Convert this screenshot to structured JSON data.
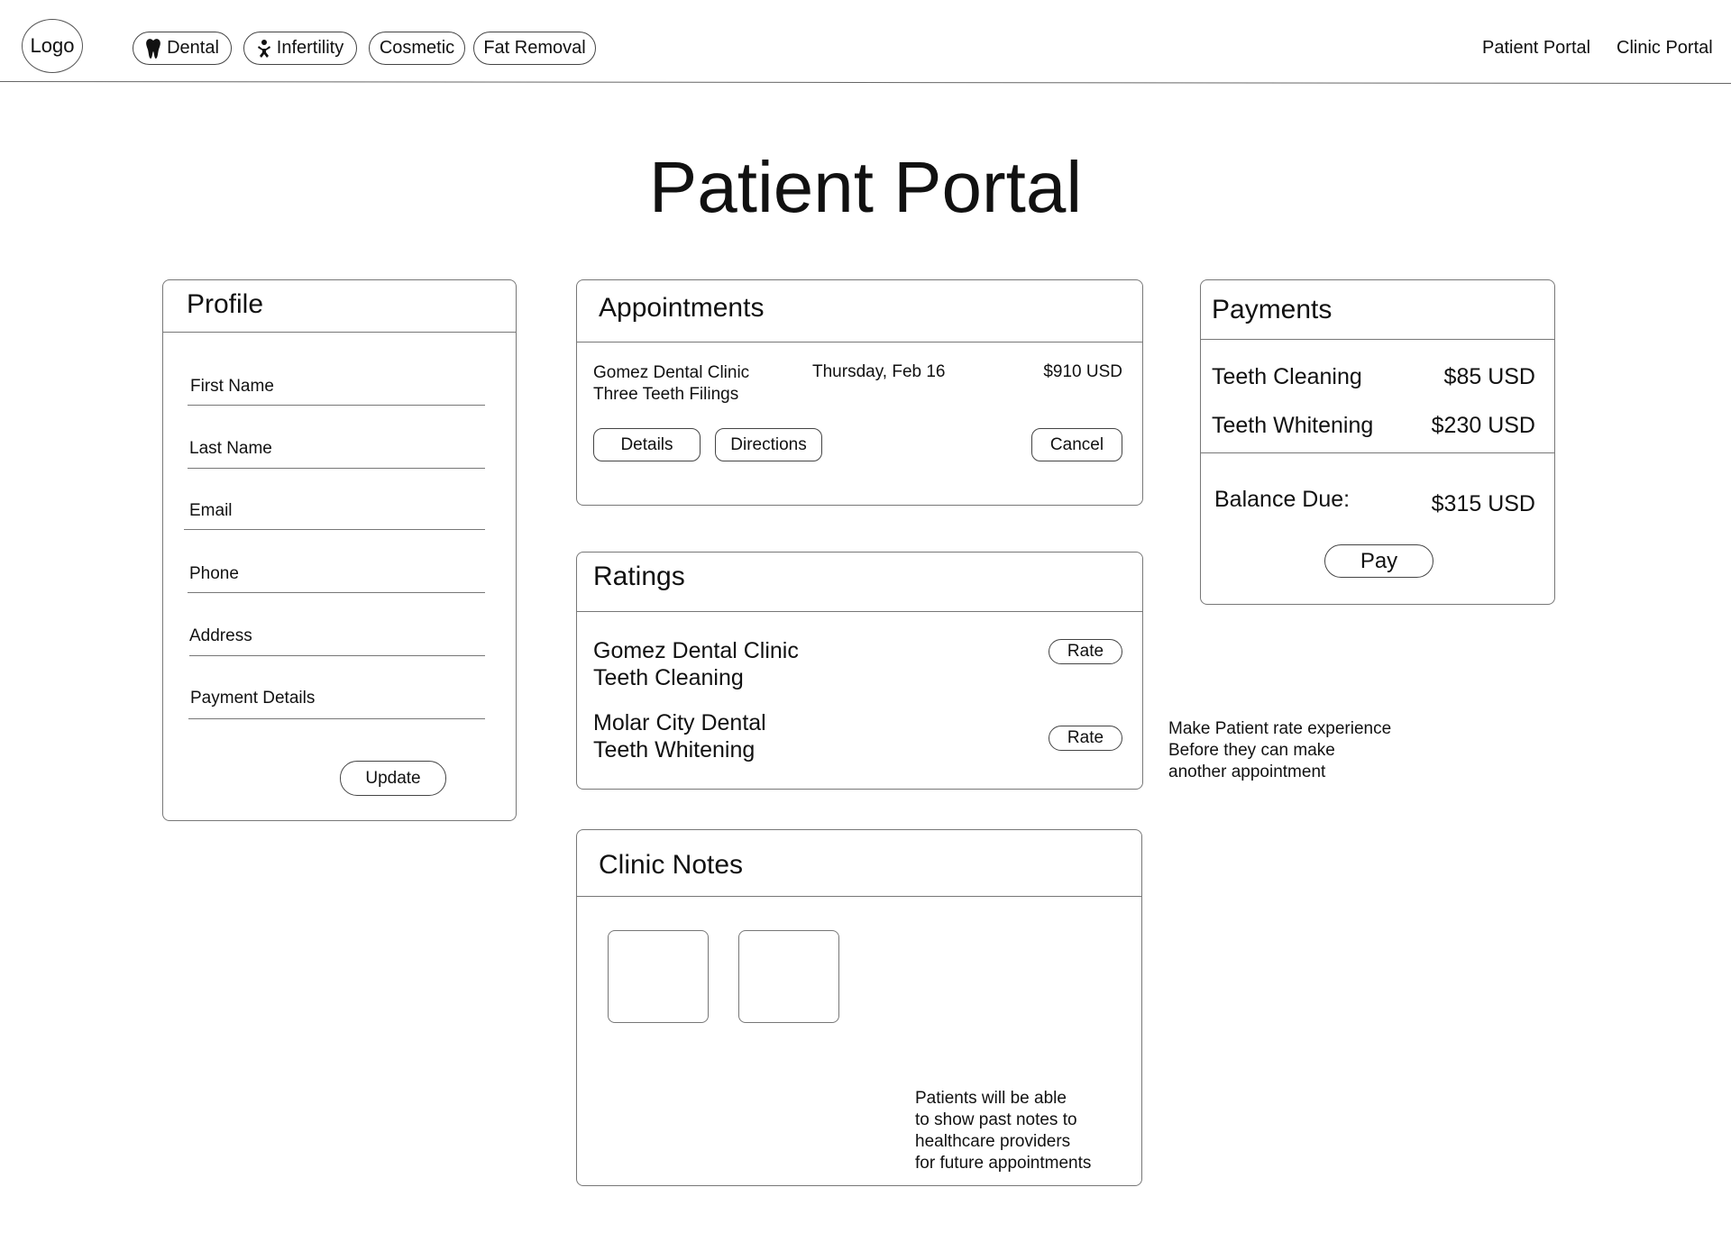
{
  "nav": {
    "logo": "Logo",
    "categories": [
      {
        "label": "Dental",
        "icon": "tooth-icon"
      },
      {
        "label": "Infertility",
        "icon": "baby-icon"
      },
      {
        "label": "Cosmetic"
      },
      {
        "label": "Fat Removal"
      }
    ],
    "links": [
      "Patient Portal",
      "Clinic Portal"
    ]
  },
  "page_title": "Patient Portal",
  "profile": {
    "title": "Profile",
    "fields": [
      "First Name",
      "Last Name",
      "Email",
      "Phone",
      "Address",
      "Payment Details"
    ],
    "update_label": "Update"
  },
  "appointments": {
    "title": "Appointments",
    "items": [
      {
        "clinic": "Gomez Dental Clinic",
        "procedure": "Three Teeth Filings",
        "date": "Thursday, Feb 16",
        "price": "$910 USD",
        "details_label": "Details",
        "directions_label": "Directions",
        "cancel_label": "Cancel"
      }
    ]
  },
  "ratings": {
    "title": "Ratings",
    "items": [
      {
        "clinic": "Gomez Dental Clinic",
        "procedure": "Teeth Cleaning",
        "rate_label": "Rate"
      },
      {
        "clinic": "Molar City Dental",
        "procedure": "Teeth Whitening",
        "rate_label": "Rate"
      }
    ],
    "annotation": [
      "Make Patient rate experience",
      "Before they can make",
      "another appointment"
    ]
  },
  "payments": {
    "title": "Payments",
    "items": [
      {
        "label": "Teeth Cleaning",
        "amount": "$85 USD"
      },
      {
        "label": "Teeth Whitening",
        "amount": "$230 USD"
      }
    ],
    "balance_label": "Balance Due:",
    "balance_amount": "$315 USD",
    "pay_label": "Pay"
  },
  "clinic_notes": {
    "title": "Clinic Notes",
    "annotation": [
      "Patients will be able",
      "to show past notes to",
      "healthcare providers",
      "for future appointments"
    ]
  }
}
